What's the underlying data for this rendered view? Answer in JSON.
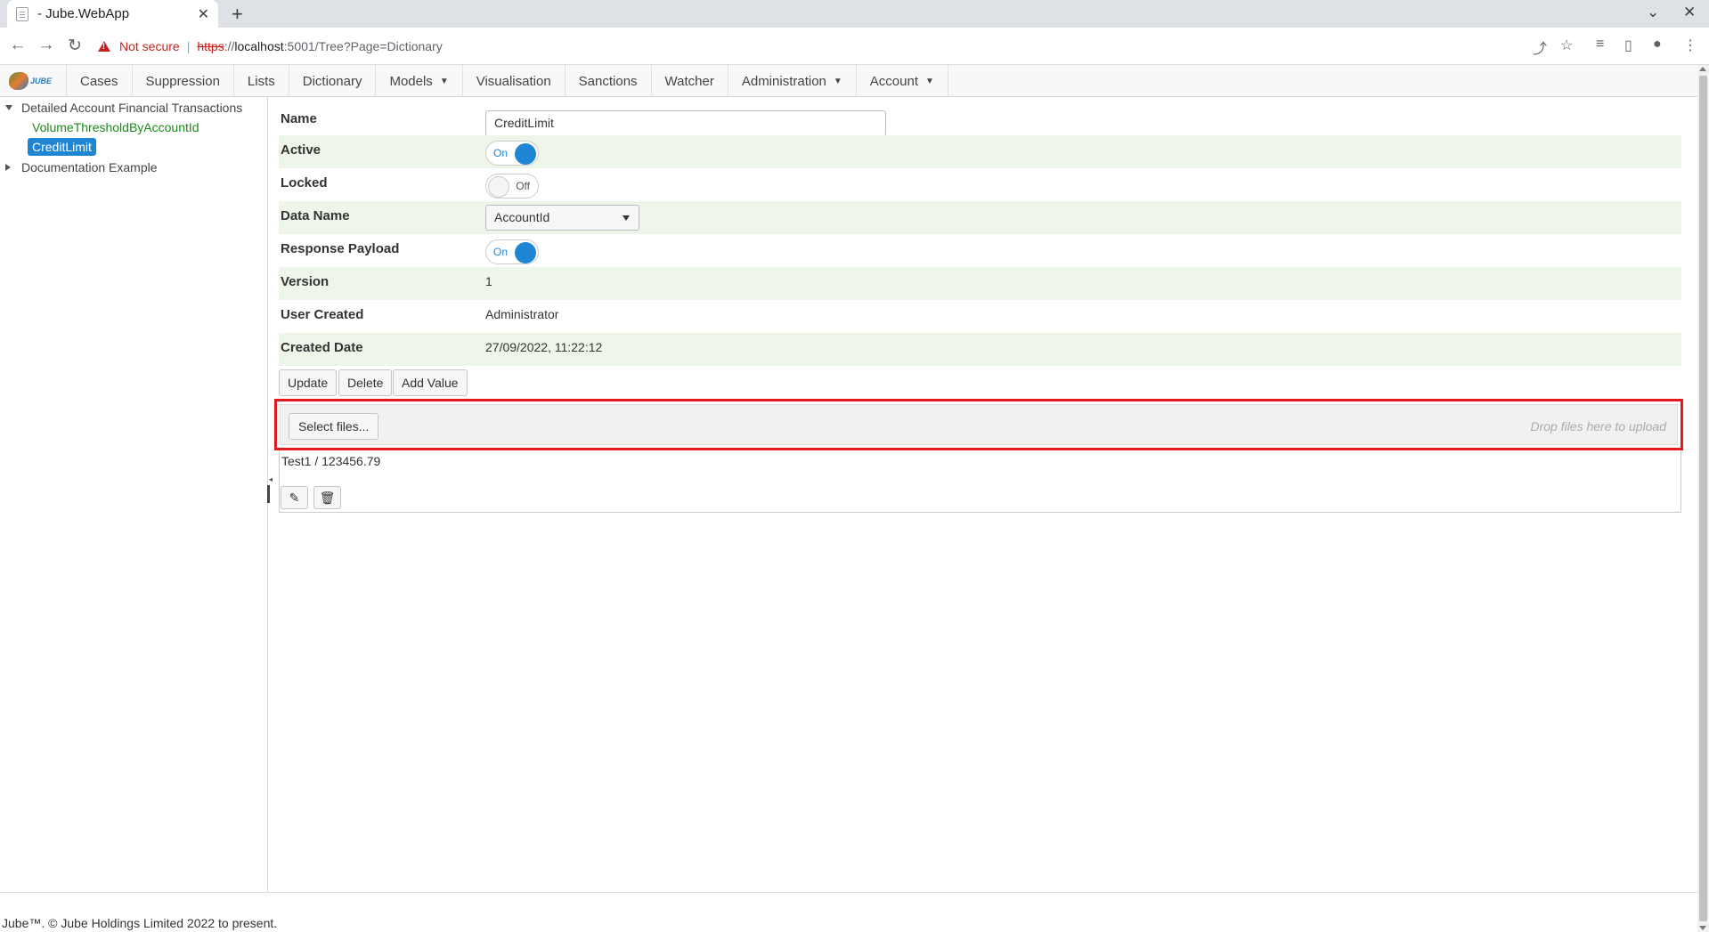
{
  "browser": {
    "tab_title": "- Jube.WebApp",
    "tab_close": "✕",
    "new_tab": "+",
    "not_secure": "Not secure",
    "url_proto": "https",
    "url_sep": "://",
    "url_host": "localhost",
    "url_rest": ":5001/Tree?Page=Dictionary",
    "minimize": "⌄",
    "close": "✕"
  },
  "nav": {
    "logo_text": "JUBE",
    "items": [
      {
        "label": "Cases",
        "dropdown": false
      },
      {
        "label": "Suppression",
        "dropdown": false
      },
      {
        "label": "Lists",
        "dropdown": false
      },
      {
        "label": "Dictionary",
        "dropdown": false
      },
      {
        "label": "Models",
        "dropdown": true
      },
      {
        "label": "Visualisation",
        "dropdown": false
      },
      {
        "label": "Sanctions",
        "dropdown": false
      },
      {
        "label": "Watcher",
        "dropdown": false
      },
      {
        "label": "Administration",
        "dropdown": true
      },
      {
        "label": "Account",
        "dropdown": true
      }
    ]
  },
  "tree": {
    "root1": "Detailed Account Financial Transactions",
    "child1": "VolumeThresholdByAccountId",
    "child2_selected": "CreditLimit",
    "root2": "Documentation Example"
  },
  "form": {
    "name_label": "Name",
    "name_value": "CreditLimit",
    "active_label": "Active",
    "active_state": "On",
    "locked_label": "Locked",
    "locked_state": "Off",
    "data_name_label": "Data Name",
    "data_name_value": "AccountId",
    "response_payload_label": "Response Payload",
    "response_payload_state": "On",
    "version_label": "Version",
    "version_value": "1",
    "user_created_label": "User Created",
    "user_created_value": "Administrator",
    "created_date_label": "Created Date",
    "created_date_value": "27/09/2022, 11:22:12"
  },
  "actions": {
    "update": "Update",
    "delete": "Delete",
    "add_value": "Add Value"
  },
  "upload": {
    "select_files": "Select files...",
    "drop_hint": "Drop files here to upload"
  },
  "values_list": {
    "item": "Test1 / 123456.79"
  },
  "footer": {
    "text": "Jube™. © Jube Holdings Limited 2022 to present."
  },
  "colors": {
    "accent": "#1f86d4",
    "highlight_border": "#e3191e",
    "row_alt": "#eef6ea",
    "tree_green": "#1a8a1a"
  }
}
